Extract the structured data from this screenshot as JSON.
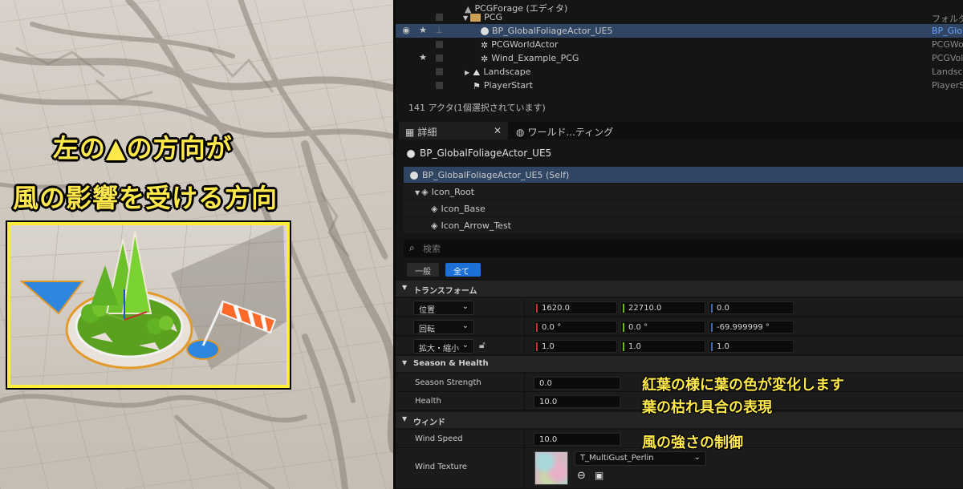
{
  "viewport": {
    "line1": "左の▲の方向が",
    "line2": "風の影響を受ける方向"
  },
  "outliner": {
    "rows": [
      {
        "label": "PCGForage (エディタ)",
        "type": ""
      },
      {
        "label": "PCG",
        "type": "フォルダ"
      },
      {
        "label": "BP_GlobalFoliageActor_UE5",
        "type": "BP_Glob"
      },
      {
        "label": "PCGWorldActor",
        "type": "PCGWo"
      },
      {
        "label": "Wind_Example_PCG",
        "type": "PCGVol"
      },
      {
        "label": "Landscape",
        "type": "Landsc"
      },
      {
        "label": "PlayerStart",
        "type": "PlayerS"
      }
    ],
    "actor_count": "141 アクタ(1個選択されています)"
  },
  "tabs": [
    {
      "label": "詳細"
    },
    {
      "label": "ワールド...ティング"
    }
  ],
  "details": {
    "title": "BP_GlobalFoliageActor_UE5",
    "components": [
      {
        "label": "BP_GlobalFoliageActor_UE5 (Self)"
      },
      {
        "label": "Icon_Root"
      },
      {
        "label": "Icon_Base"
      },
      {
        "label": "Icon_Arrow_Test"
      }
    ],
    "search_placeholder": "検索",
    "filters": {
      "basic": "一般",
      "all": "全て"
    },
    "transform": {
      "section": "トランスフォーム",
      "location": {
        "label": "位置",
        "x": "1620.0",
        "y": "22710.0",
        "z": "0.0"
      },
      "rotation": {
        "label": "回転",
        "x": "0.0 °",
        "y": "0.0 °",
        "z": "-69.999999 °"
      },
      "scale": {
        "label": "拡大・縮小",
        "x": "1.0",
        "y": "1.0",
        "z": "1.0"
      }
    },
    "season": {
      "section": "Season & Health",
      "strength_label": "Season Strength",
      "strength_value": "0.0",
      "health_label": "Health",
      "health_value": "10.0"
    },
    "wind": {
      "section": "ウィンド",
      "speed_label": "Wind Speed",
      "speed_value": "10.0",
      "texture_label": "Wind Texture",
      "texture_value": "T_MultiGust_Perlin"
    }
  },
  "annotations": {
    "a1": "紅葉の様に葉の色が変化します",
    "a2": "葉の枯れ具合の表現",
    "a3": "風の強さの制御"
  },
  "colors": {
    "highlight": "#ffe94a",
    "selection": "#2f4563",
    "accent": "#1c70d8",
    "axis_x": "#c0322f",
    "axis_y": "#6fb52c",
    "axis_z": "#2f6fc9"
  }
}
